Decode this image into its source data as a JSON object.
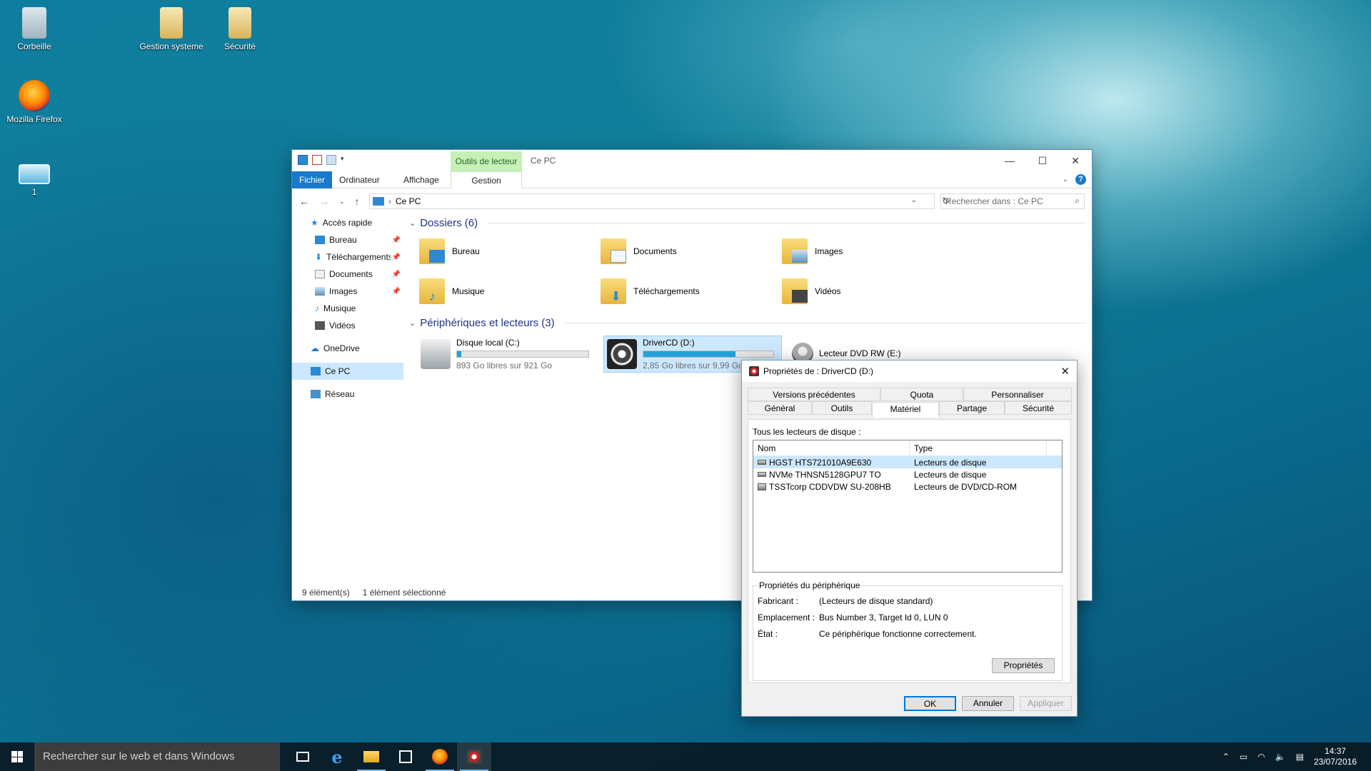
{
  "desktop": {
    "icons": [
      {
        "label": "Corbeille"
      },
      {
        "label": "Gestion systeme"
      },
      {
        "label": "Sécurité"
      },
      {
        "label": "Mozilla Firefox"
      },
      {
        "label": "1"
      }
    ]
  },
  "explorer": {
    "title": "Ce PC",
    "context_tab": "Outils de lecteur",
    "ribbon_tabs": [
      "Fichier",
      "Ordinateur",
      "Affichage",
      "Gestion"
    ],
    "address": "Ce PC",
    "search_placeholder": "Rechercher dans : Ce PC",
    "nav": {
      "quick_access": "Accès rapide",
      "items": [
        "Bureau",
        "Téléchargements",
        "Documents",
        "Images",
        "Musique",
        "Vidéos"
      ],
      "onedrive": "OneDrive",
      "this_pc": "Ce PC",
      "network": "Réseau"
    },
    "folders_header": "Dossiers (6)",
    "folders": [
      "Bureau",
      "Documents",
      "Images",
      "Musique",
      "Téléchargements",
      "Vidéos"
    ],
    "drives_header": "Périphériques et lecteurs (3)",
    "drives": [
      {
        "name": "Disque local (C:)",
        "free": "893 Go libres sur 921 Go",
        "used_fraction": 0.03
      },
      {
        "name": "DriverCD (D:)",
        "free": "2,85 Go libres sur 9,99 Go",
        "used_fraction": 0.71
      },
      {
        "name": "Lecteur DVD RW (E:)"
      }
    ],
    "status": {
      "count": "9 élément(s)",
      "selected": "1 élément sélectionné"
    }
  },
  "dialog": {
    "title": "Propriétés de : DriverCD (D:)",
    "tabs_row1": [
      "Versions précédentes",
      "Quota",
      "Personnaliser"
    ],
    "tabs_row2": [
      "Général",
      "Outils",
      "Matériel",
      "Partage",
      "Sécurité"
    ],
    "all_drives_label": "Tous les lecteurs de disque :",
    "columns": [
      "Nom",
      "Type"
    ],
    "rows": [
      {
        "name": "HGST HTS721010A9E630",
        "type": "Lecteurs de disque"
      },
      {
        "name": "NVMe THNSN5128GPU7 TO",
        "type": "Lecteurs de disque"
      },
      {
        "name": "TSSTcorp CDDVDW SU-208HB",
        "type": "Lecteurs de DVD/CD-ROM"
      }
    ],
    "device_props_label": "Propriétés du périphérique",
    "props": [
      {
        "k": "Fabricant :",
        "v": "(Lecteurs de disque standard)"
      },
      {
        "k": "Emplacement :",
        "v": "Bus Number 3, Target Id 0, LUN 0"
      },
      {
        "k": "État :",
        "v": "Ce périphérique fonctionne correctement."
      }
    ],
    "properties_button": "Propriétés",
    "ok": "OK",
    "cancel": "Annuler",
    "apply": "Appliquer"
  },
  "taskbar": {
    "search": "Rechercher sur le web et dans Windows",
    "time": "14:37",
    "date": "23/07/2016"
  }
}
